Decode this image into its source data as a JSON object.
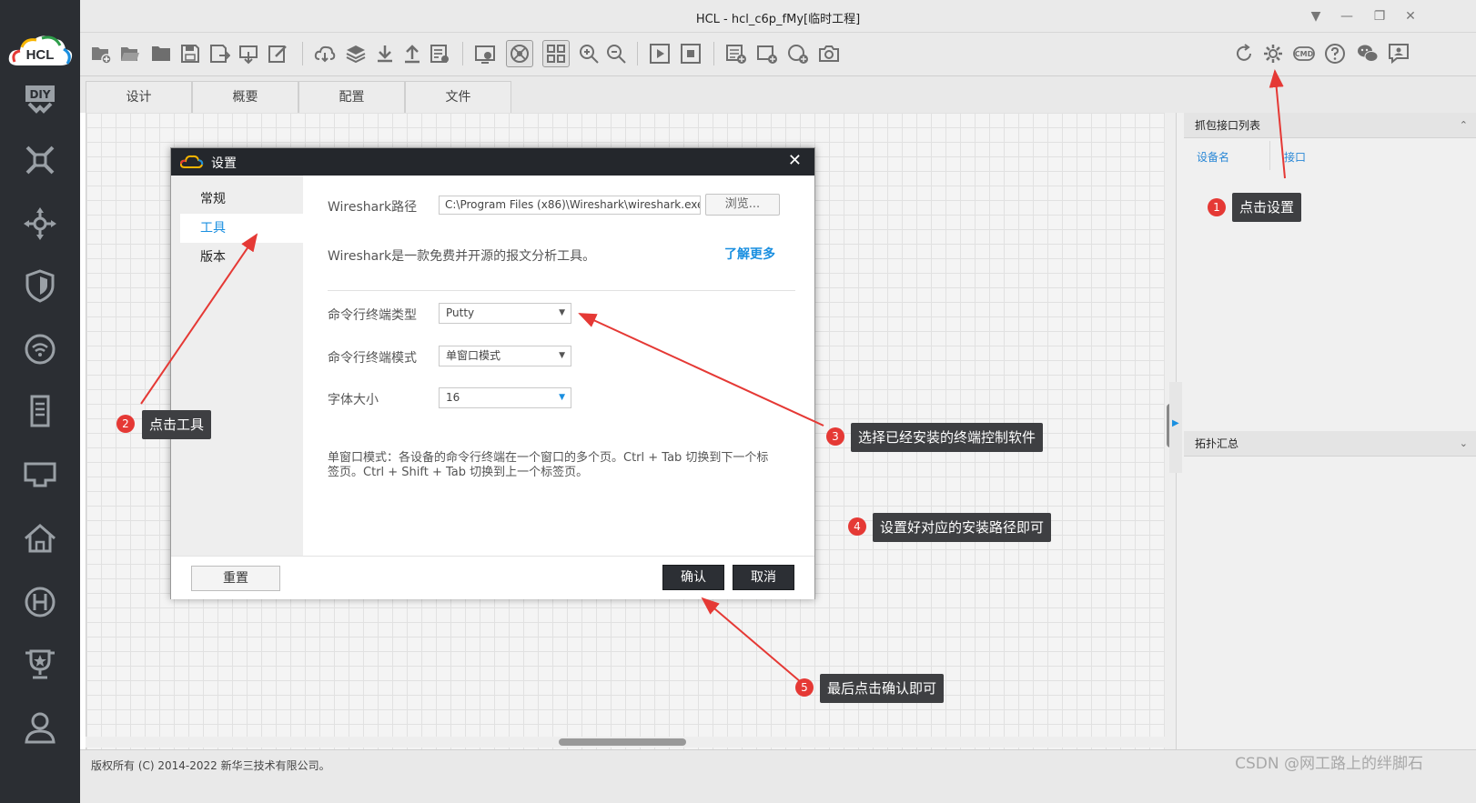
{
  "window": {
    "title": "HCL - hcl_c6p_fMy[临时工程]"
  },
  "logo_text": "HCL",
  "sidebar": {
    "icons": [
      "diy-icon",
      "topology-icon",
      "move-icon",
      "shield-icon",
      "wifi-icon",
      "server-icon",
      "terminal-icon",
      "home-icon",
      "h-icon",
      "trophy-icon",
      "user-icon"
    ],
    "diy_label": "DIY"
  },
  "toolbar": {
    "left_icons": [
      "new-project-icon",
      "open-icon",
      "folder-icon",
      "save-icon",
      "save-as-icon",
      "export-icon",
      "edit-icon",
      "cloud-icon",
      "layers-icon",
      "download-icon",
      "upload-icon",
      "log-icon",
      "screenshot-icon",
      "globe-icon",
      "grid-icon",
      "zoom-in-icon",
      "zoom-out-icon",
      "play-icon",
      "stop-icon",
      "list-add-icon",
      "rect-add-icon",
      "circle-add-icon",
      "camera-icon"
    ],
    "right_icons": [
      "refresh-icon",
      "gear-icon",
      "cmd-icon",
      "help-icon",
      "wechat-icon",
      "feedback-icon"
    ],
    "cmd_label": "CMD"
  },
  "tabs": [
    {
      "label": "设计"
    },
    {
      "label": "概要"
    },
    {
      "label": "配置"
    },
    {
      "label": "文件"
    }
  ],
  "right_panel": {
    "capture_title": "抓包接口列表",
    "col_device": "设备名",
    "col_interface": "接口",
    "topology_title": "拓扑汇总"
  },
  "status": {
    "copyright": "版权所有 (C) 2014-2022 新华三技术有限公司。",
    "watermark": "CSDN @网工路上的绊脚石"
  },
  "dialog": {
    "title": "设置",
    "nav": [
      {
        "label": "常规"
      },
      {
        "label": "工具"
      },
      {
        "label": "版本"
      }
    ],
    "active_nav": "工具",
    "wireshark_label": "Wireshark路径",
    "wireshark_path": "C:\\Program Files (x86)\\Wireshark\\wireshark.exe",
    "browse_label": "浏览...",
    "wireshark_desc": "Wireshark是一款免费并开源的报文分析工具。",
    "learn_more": "了解更多",
    "terminal_type_label": "命令行终端类型",
    "terminal_type_value": "Putty",
    "terminal_mode_label": "命令行终端模式",
    "terminal_mode_value": "单窗口模式",
    "font_size_label": "字体大小",
    "font_size_value": "16",
    "note_line1": "单窗口模式：各设备的命令行终端在一个窗口的多个页。Ctrl + Tab 切换到下一个标",
    "note_line2": "签页。Ctrl + Shift + Tab 切换到上一个标签页。",
    "reset_label": "重置",
    "ok_label": "确认",
    "cancel_label": "取消"
  },
  "annotations": [
    {
      "num": "1",
      "text": "点击设置"
    },
    {
      "num": "2",
      "text": "点击工具"
    },
    {
      "num": "3",
      "text": "选择已经安装的终端控制软件"
    },
    {
      "num": "4",
      "text": "设置好对应的安装路径即可"
    },
    {
      "num": "5",
      "text": "最后点击确认即可"
    }
  ],
  "colors": {
    "accent": "#1a8fe0",
    "annotation_bg": "#3e3f42",
    "badge": "#e53935",
    "sidebar_bg": "#2b2e33",
    "dialog_title_bg": "#24272c"
  }
}
